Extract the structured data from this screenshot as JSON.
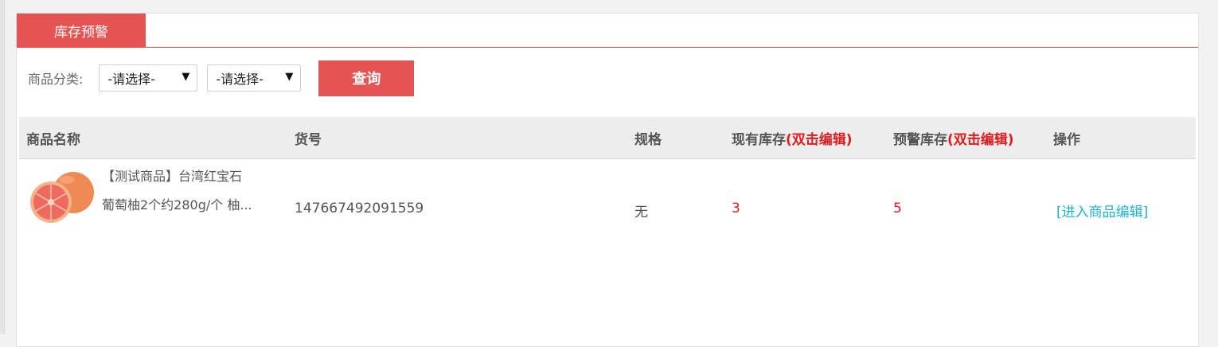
{
  "tabs": {
    "active": "库存预警"
  },
  "filter": {
    "label": "商品分类:",
    "select1": "-请选择-",
    "select2": "-请选择-",
    "query_button": "查询"
  },
  "table": {
    "headers": {
      "name": "商品名称",
      "sku": "货号",
      "spec": "规格",
      "stock": "现有库存",
      "stock_hint": "(双击编辑)",
      "warn": "预警库存",
      "warn_hint": "(双击编辑)",
      "action": "操作"
    },
    "rows": [
      {
        "name_line1": "【测试商品】台湾红宝石",
        "name_line2": "葡萄柚2个约280g/个 柚...",
        "sku": "147667492091559",
        "spec": "无",
        "stock": "3",
        "warn_stock": "5",
        "action": "[进入商品编辑]"
      }
    ]
  },
  "colors": {
    "accent": "#e55353",
    "warning_text": "#e11b1b",
    "link": "#1fb0d8"
  }
}
